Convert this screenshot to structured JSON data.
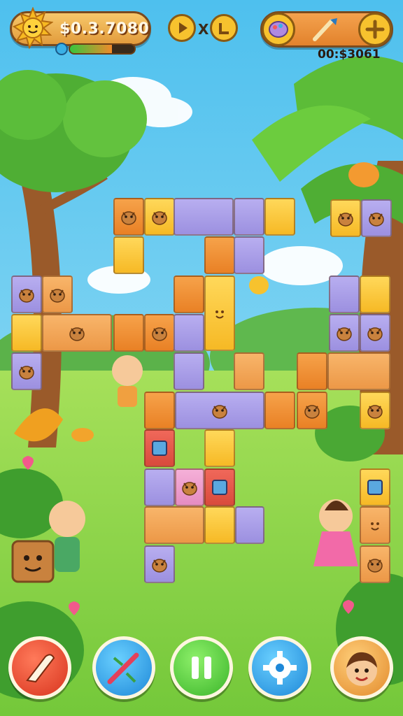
{
  "hud": {
    "coins": "$0.3.7080",
    "energy_level": 0.65,
    "multiplier_symbol": "X",
    "timer": "00:$3061"
  },
  "icons": [
    "sun-icon",
    "play-icon",
    "skip-icon",
    "paint-palette-icon",
    "paintbrush-icon",
    "plus-icon",
    "eraser-icon",
    "magic-wand-icon",
    "pause-icon",
    "gear-icon",
    "avatar-icon"
  ],
  "colors": {
    "sky": "#5fc8ee",
    "grass": "#8ed84a",
    "hud_orange": "#e88a2c",
    "tile_purple": "#a89ee8",
    "tile_yellow": "#f8c83a",
    "tile_orange": "#ee8c32"
  }
}
